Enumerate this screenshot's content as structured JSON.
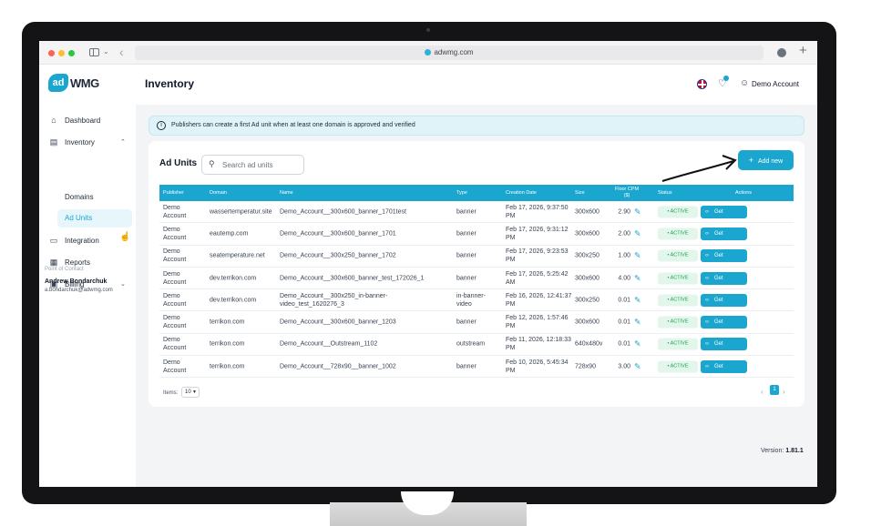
{
  "browser": {
    "url": "adwmg.com"
  },
  "app": {
    "logo_badge": "ad",
    "logo_text": "WMG",
    "page_title": "Inventory",
    "account_name": "Demo Account"
  },
  "sidebar": {
    "items": [
      {
        "label": "Dashboard",
        "icon": "home-icon"
      },
      {
        "label": "Inventory",
        "icon": "box-icon"
      },
      {
        "label": "Integration",
        "icon": "code-icon"
      },
      {
        "label": "Reports",
        "icon": "report-icon"
      },
      {
        "label": "Billing",
        "icon": "wallet-icon"
      }
    ],
    "sub_items": [
      "Domains",
      "Ad Units"
    ],
    "contact": {
      "label": "Point of Contact",
      "name": "Andrew Bondarchuk",
      "email": "a.bondarchuk@adwmg.com"
    }
  },
  "banner": {
    "text": "Publishers can create a first Ad unit when at least one domain is approved and verified"
  },
  "card": {
    "title": "Ad Units",
    "search_placeholder": "Search ad units",
    "add_label": "Add new"
  },
  "table": {
    "columns": [
      "Publisher",
      "Domain",
      "Name",
      "Type",
      "Creation Date",
      "Size",
      "Floor CPM ($)",
      "Status",
      "Actions"
    ],
    "rows": [
      {
        "publisher": "Demo Account",
        "domain": "wassertemperatur.site",
        "name": "Demo_Account__300x600_banner_1701test",
        "type": "banner",
        "date": "Feb 17, 2026, 9:37:50 PM",
        "size": "300x600",
        "cpm": "2.90",
        "status": "• ACTIVE",
        "action": "Get"
      },
      {
        "publisher": "Demo Account",
        "domain": "eautemp.com",
        "name": "Demo_Account__300x600_banner_1701",
        "type": "banner",
        "date": "Feb 17, 2026, 9:31:12 PM",
        "size": "300x600",
        "cpm": "2.00",
        "status": "• ACTIVE",
        "action": "Get"
      },
      {
        "publisher": "Demo Account",
        "domain": "seatemperature.net",
        "name": "Demo_Account__300x250_banner_1702",
        "type": "banner",
        "date": "Feb 17, 2026, 9:23:53 PM",
        "size": "300x250",
        "cpm": "1.00",
        "status": "• ACTIVE",
        "action": "Get"
      },
      {
        "publisher": "Demo Account",
        "domain": "dev.terrikon.com",
        "name": "Demo_Account__300x600_banner_test_172026_1",
        "type": "banner",
        "date": "Feb 17, 2026, 5:25:42 AM",
        "size": "300x600",
        "cpm": "4.00",
        "status": "• ACTIVE",
        "action": "Get"
      },
      {
        "publisher": "Demo Account",
        "domain": "dev.terrikon.com",
        "name": "Demo_Account__300x250_in-banner-video_test_1620276_3",
        "type": "in-banner-video",
        "date": "Feb 16, 2026, 12:41:37 PM",
        "size": "300x250",
        "cpm": "0.01",
        "status": "• ACTIVE",
        "action": "Get"
      },
      {
        "publisher": "Demo Account",
        "domain": "terrikon.com",
        "name": "Demo_Account__300x600_banner_1203",
        "type": "banner",
        "date": "Feb 12, 2026, 1:57:46 PM",
        "size": "300x600",
        "cpm": "0.01",
        "status": "• ACTIVE",
        "action": "Get"
      },
      {
        "publisher": "Demo Account",
        "domain": "terrikon.com",
        "name": "Demo_Account__Outstream_1102",
        "type": "outstream",
        "date": "Feb 11, 2026, 12:18:33 PM",
        "size": "640x480v",
        "cpm": "0.01",
        "status": "• ACTIVE",
        "action": "Get"
      },
      {
        "publisher": "Demo Account",
        "domain": "terrikon.com",
        "name": "Demo_Account__728x90__banner_1002",
        "type": "banner",
        "date": "Feb 10, 2026, 5:45:34 PM",
        "size": "728x90",
        "cpm": "3.00",
        "status": "• ACTIVE",
        "action": "Get"
      }
    ]
  },
  "pagination": {
    "items_label": "Items:",
    "items_value": "10",
    "current_page": "1"
  },
  "footer": {
    "version_label": "Version:",
    "version_value": "1.81.1"
  },
  "colors": {
    "accent": "#1aa6cf",
    "status_green": "#16a34a"
  }
}
